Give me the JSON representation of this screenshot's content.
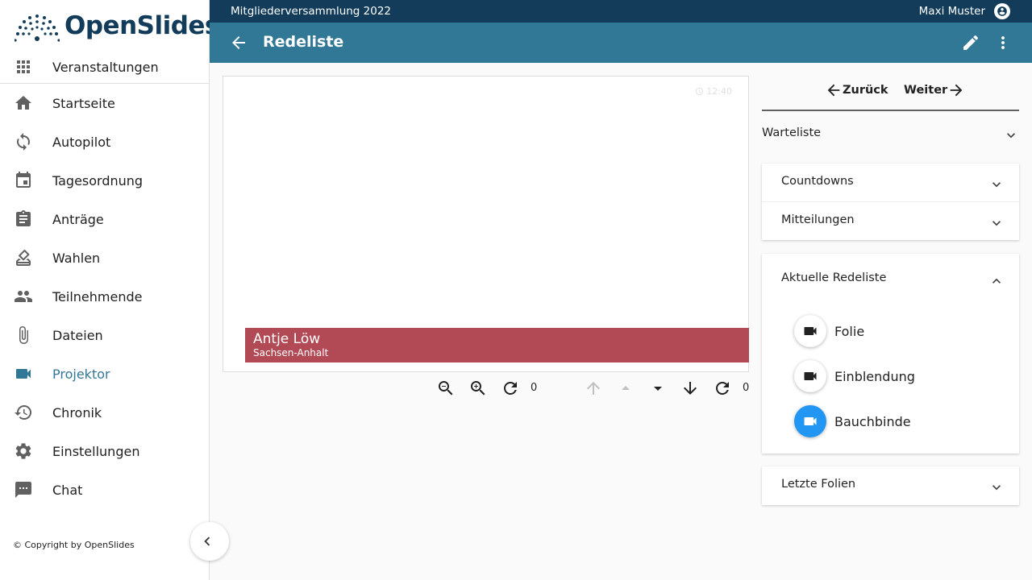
{
  "app": {
    "name": "OpenSlides"
  },
  "topbar": {
    "meeting_title": "Mitgliederversammlung 2022",
    "user_name": "Maxi Muster"
  },
  "toolbar": {
    "title": "Redeliste"
  },
  "sidebar": {
    "top_item": {
      "label": "Veranstaltungen",
      "icon": "apps-icon"
    },
    "items": [
      {
        "label": "Startseite",
        "icon": "home-icon",
        "active": false
      },
      {
        "label": "Autopilot",
        "icon": "sync-icon",
        "active": false
      },
      {
        "label": "Tagesordnung",
        "icon": "calendar-icon",
        "active": false
      },
      {
        "label": "Anträge",
        "icon": "assignment-icon",
        "active": false
      },
      {
        "label": "Wahlen",
        "icon": "ballot-icon",
        "active": false
      },
      {
        "label": "Teilnehmende",
        "icon": "people-icon",
        "active": false
      },
      {
        "label": "Dateien",
        "icon": "attachment-icon",
        "active": false
      },
      {
        "label": "Projektor",
        "icon": "videocam-icon",
        "active": true
      },
      {
        "label": "Chronik",
        "icon": "history-icon",
        "active": false
      },
      {
        "label": "Einstellungen",
        "icon": "settings-icon",
        "active": false
      },
      {
        "label": "Chat",
        "icon": "chat-icon",
        "active": false
      }
    ],
    "copyright": "©  Copyright by OpenSlides"
  },
  "projector": {
    "clock": "12:40",
    "lower_third": {
      "name": "Antje Löw",
      "subtitle": "Sachsen-Anhalt"
    },
    "zoom_value": "0",
    "scroll_value": "0"
  },
  "right_panel": {
    "nav": {
      "back_label": "Zurück",
      "next_label": "Weiter"
    },
    "waitlist_label": "Warteliste",
    "countdowns_label": "Countdowns",
    "messages_label": "Mitteilungen",
    "current_list": {
      "title": "Aktuelle Redeliste",
      "items": [
        {
          "label": "Folie",
          "projected": false
        },
        {
          "label": "Einblendung",
          "projected": false
        },
        {
          "label": "Bauchbinde",
          "projected": true
        }
      ]
    },
    "recent_label": "Letzte Folien"
  },
  "colors": {
    "topbar": "#123c59",
    "toolbar": "#317796",
    "active_nav": "#317796",
    "lower_third": "#b24a55",
    "projected_button": "#2196f3"
  }
}
